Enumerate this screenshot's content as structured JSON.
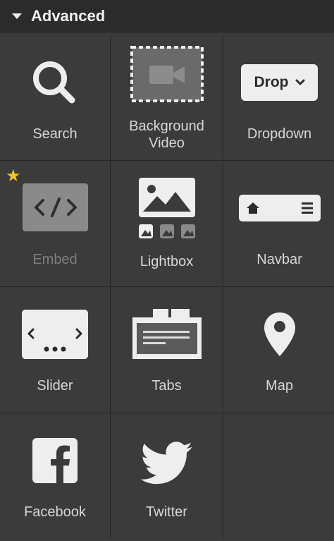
{
  "header": {
    "title": "Advanced"
  },
  "items": [
    {
      "label": "Search"
    },
    {
      "label": "Background Video",
      "label_line1": "Background",
      "label_line2": "Video"
    },
    {
      "label": "Dropdown",
      "button_text": "Drop"
    },
    {
      "label": "Embed",
      "starred": true,
      "disabled": true
    },
    {
      "label": "Lightbox"
    },
    {
      "label": "Navbar"
    },
    {
      "label": "Slider"
    },
    {
      "label": "Tabs"
    },
    {
      "label": "Map"
    },
    {
      "label": "Facebook"
    },
    {
      "label": "Twitter"
    }
  ],
  "icons": {
    "star": "star-icon",
    "colors": {
      "panel": "#3b3b3b",
      "header": "#2b2b2b",
      "star": "#f5c518",
      "icon": "#eeeeee",
      "text": "#d6d6d6"
    }
  }
}
